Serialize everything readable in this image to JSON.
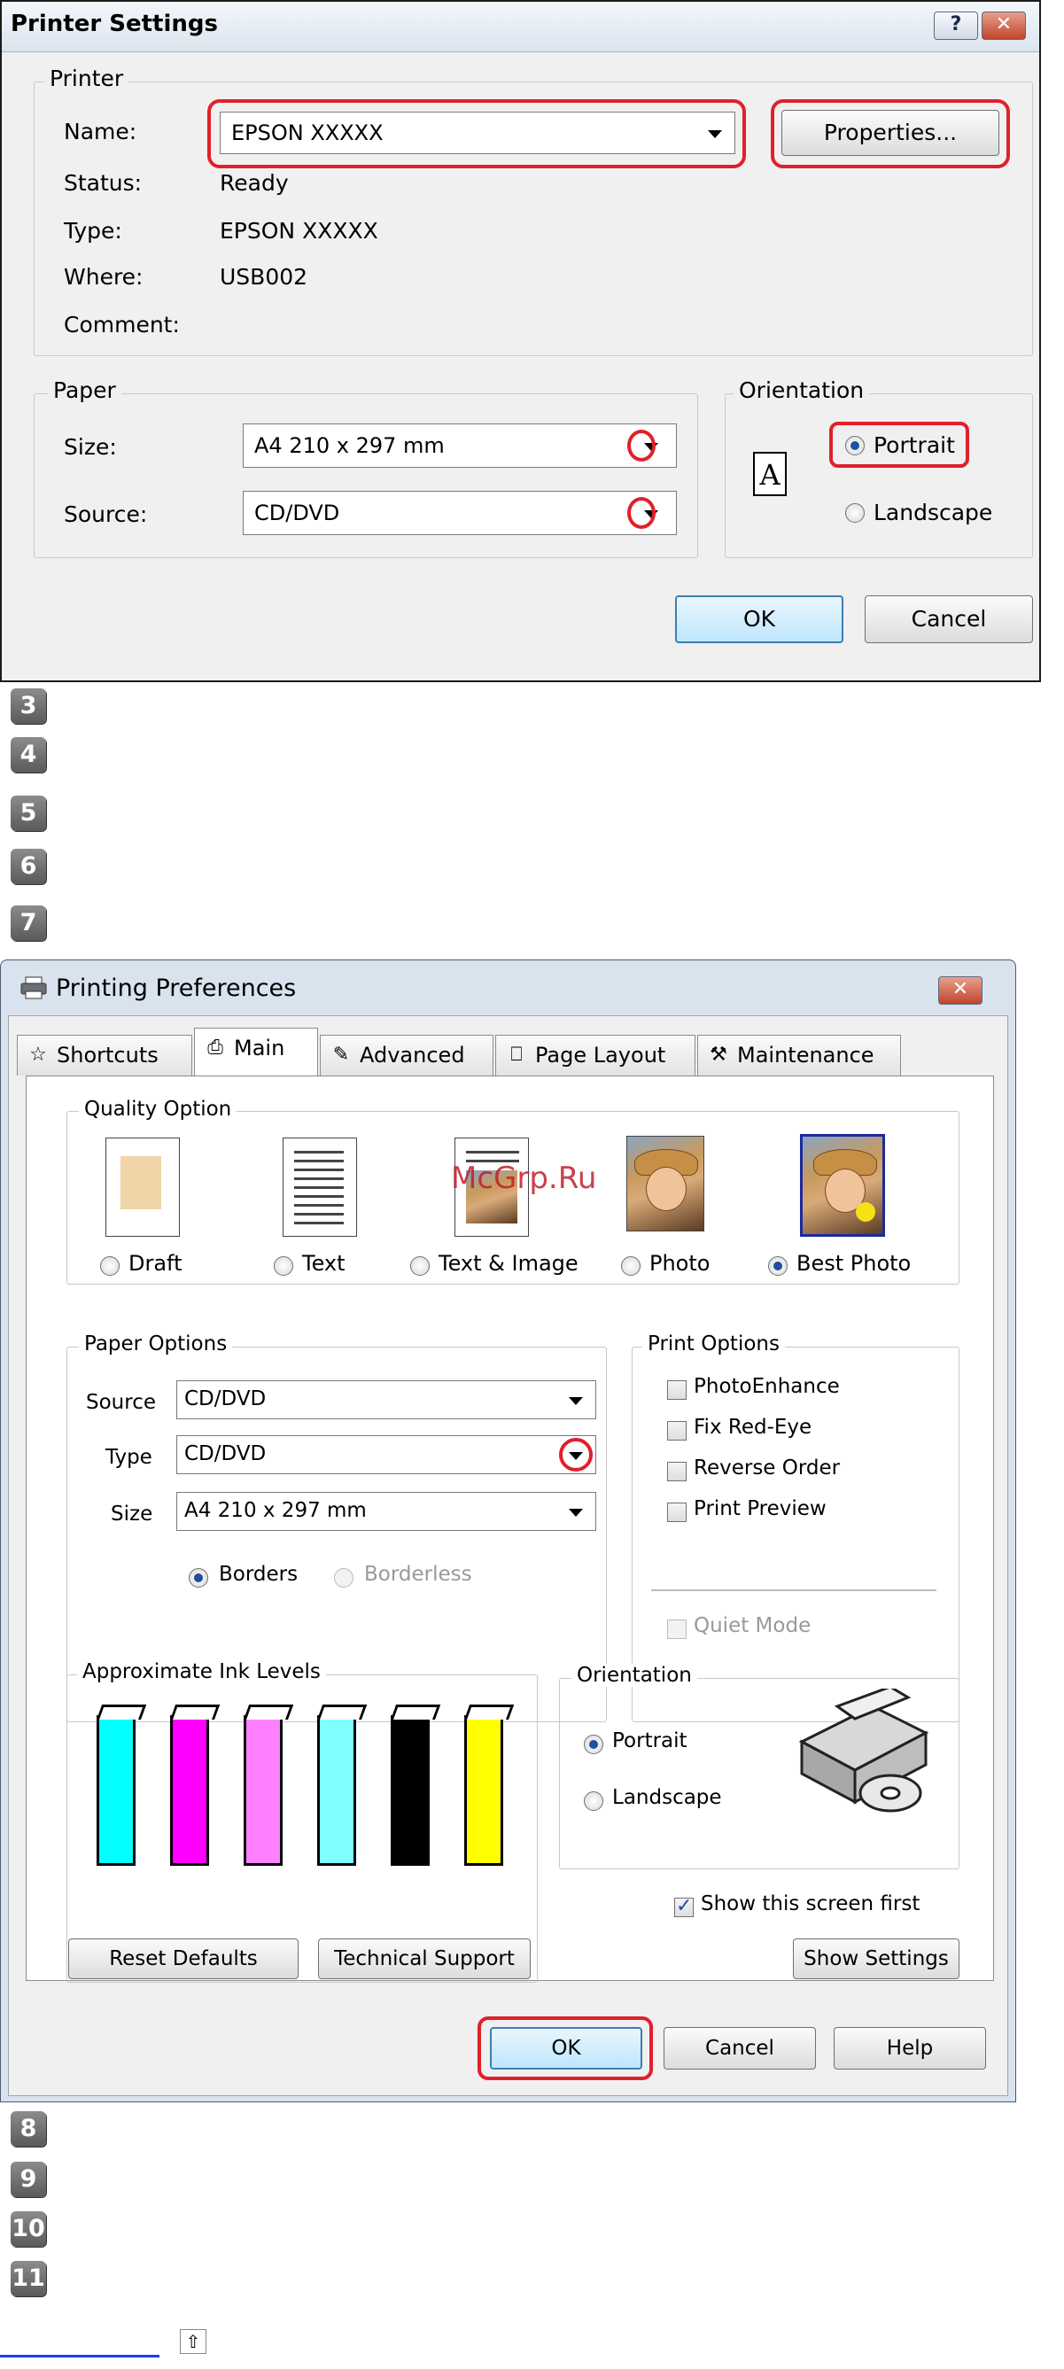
{
  "printer_settings": {
    "title": "Printer Settings",
    "help_glyph": "?",
    "close_glyph": "✕",
    "printer_group": "Printer",
    "name_label": "Name:",
    "name_value": "EPSON XXXXX",
    "properties_button": "Properties...",
    "status_label": "Status:",
    "status_value": "Ready",
    "type_label": "Type:",
    "type_value": "EPSON XXXXX",
    "where_label": "Where:",
    "where_value": "USB002",
    "comment_label": "Comment:",
    "paper_group": "Paper",
    "size_label": "Size:",
    "size_value": "A4 210 x 297 mm",
    "source_label": "Source:",
    "source_value": "CD/DVD",
    "orientation_group": "Orientation",
    "orientation_icon_letter": "A",
    "portrait_label": "Portrait",
    "landscape_label": "Landscape",
    "orientation_selected": "Portrait",
    "ok_button": "OK",
    "cancel_button": "Cancel"
  },
  "steps_a": [
    "3",
    "4",
    "5",
    "6",
    "7"
  ],
  "steps_b": [
    "8",
    "9",
    "10",
    "11"
  ],
  "preferences": {
    "title": "Printing Preferences",
    "close_glyph": "✕",
    "tabs": [
      {
        "label": "Shortcuts",
        "icon": "star-icon"
      },
      {
        "label": "Main",
        "icon": "printer-icon",
        "active": true
      },
      {
        "label": "Advanced",
        "icon": "advanced-icon"
      },
      {
        "label": "Page Layout",
        "icon": "page-layout-icon"
      },
      {
        "label": "Maintenance",
        "icon": "maintenance-icon"
      }
    ],
    "quality_group": "Quality Option",
    "quality_options": [
      "Draft",
      "Text",
      "Text & Image",
      "Photo",
      "Best Photo"
    ],
    "quality_selected": "Best Photo",
    "watermark": "McGrp.Ru",
    "paper_options_group": "Paper Options",
    "source_label": "Source",
    "source_value": "CD/DVD",
    "type_label": "Type",
    "type_value": "CD/DVD",
    "size_label": "Size",
    "size_value": "A4 210 x 297 mm",
    "borders_label": "Borders",
    "borderless_label": "Borderless",
    "print_options_group": "Print Options",
    "print_options": [
      "PhotoEnhance",
      "Fix Red-Eye",
      "Reverse Order",
      "Print Preview"
    ],
    "quiet_mode_label": "Quiet Mode",
    "ink_group": "Approximate Ink Levels",
    "ink_colors": [
      "#00ffff",
      "#ff00ff",
      "#ff80ff",
      "#80ffff",
      "#000000",
      "#ffff00"
    ],
    "orientation_group": "Orientation",
    "portrait_label": "Portrait",
    "landscape_label": "Landscape",
    "show_first_label": "Show this screen first",
    "show_first_checked": true,
    "reset_button": "Reset Defaults",
    "tech_button": "Technical Support",
    "show_settings_button": "Show Settings",
    "ok_button": "OK",
    "cancel_button": "Cancel",
    "help_button": "Help"
  },
  "footer": {
    "up_glyph": "⇧"
  },
  "colors": {
    "highlight_red": "#e0202a",
    "radio_blue": "#1f4f9e"
  }
}
